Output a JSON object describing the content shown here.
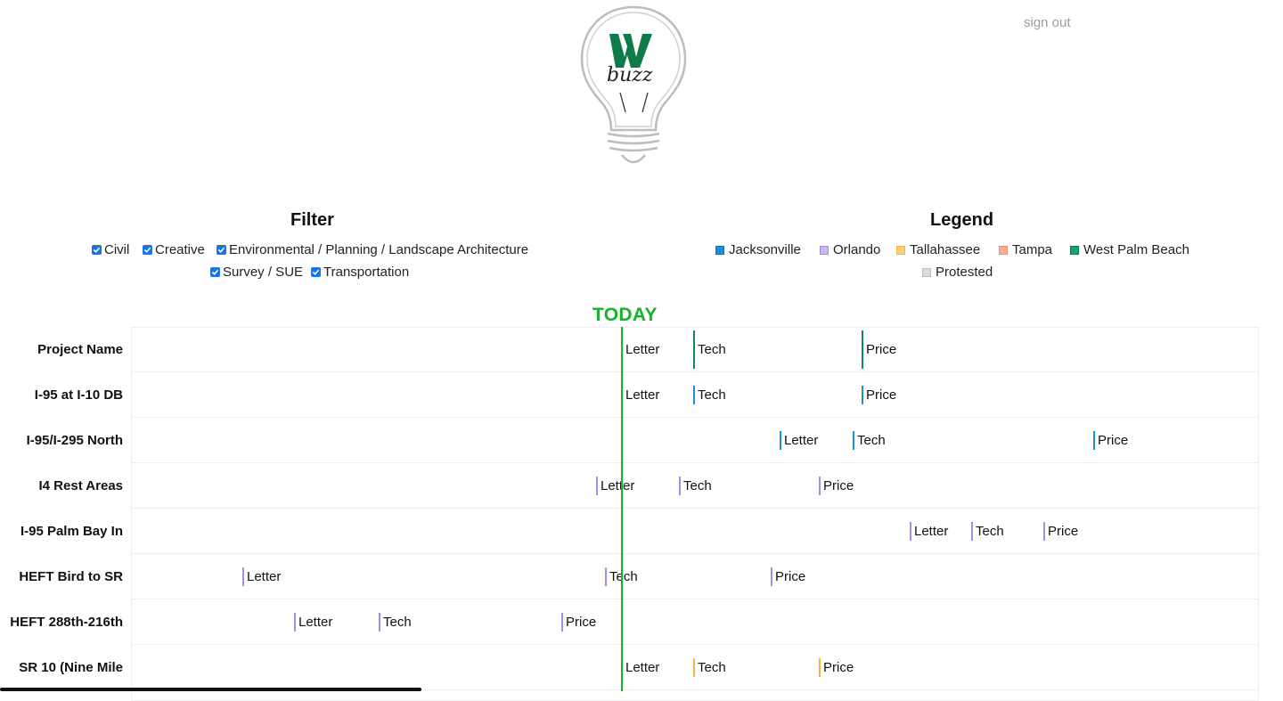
{
  "header": {
    "logo_icon": "lightbulb-wbuzz-logo",
    "logo_text": "buzz",
    "sign_out_label": "sign out"
  },
  "filter": {
    "title": "Filter",
    "options": [
      {
        "label": "Civil",
        "checked": true
      },
      {
        "label": "Creative",
        "checked": true
      },
      {
        "label": "Environmental / Planning / Landscape Architecture",
        "checked": true
      },
      {
        "label": "Survey / SUE",
        "checked": true
      },
      {
        "label": "Transportation",
        "checked": true
      }
    ]
  },
  "legend": {
    "title": "Legend",
    "items": [
      {
        "label": "Jacksonville",
        "color": "#1a8fd6"
      },
      {
        "label": "Orlando",
        "color": "#a98be6"
      },
      {
        "label": "Tallahassee",
        "color": "#f7b23e"
      },
      {
        "label": "Tampa",
        "color": "#f28b6e"
      },
      {
        "label": "West Palm Beach",
        "color": "#0f9d58"
      },
      {
        "label": "Protested",
        "color": "#d3d3d3"
      }
    ]
  },
  "timeline": {
    "today_label": "TODAY",
    "today_color": "#13b32a",
    "rows": [
      {
        "name": "Project Name",
        "color": "#0f8a5a",
        "markers": [
          {
            "label": "Letter"
          },
          {
            "label": "Tech"
          },
          {
            "label": "Price"
          }
        ]
      },
      {
        "name": "I-95 at I-10 DB",
        "color": "#1a8fd6",
        "markers": [
          {
            "label": "Letter"
          },
          {
            "label": "Tech"
          },
          {
            "label": "Price"
          }
        ]
      },
      {
        "name": "I-95/I-295 North",
        "color": "#1a8fd6",
        "markers": [
          {
            "label": "Letter"
          },
          {
            "label": "Tech"
          },
          {
            "label": "Price"
          }
        ]
      },
      {
        "name": "I4 Rest Areas",
        "color": "#a98be6",
        "markers": [
          {
            "label": "Letter"
          },
          {
            "label": "Tech"
          },
          {
            "label": "Price"
          }
        ]
      },
      {
        "name": "I-95 Palm Bay In",
        "color": "#a98be6",
        "markers": [
          {
            "label": "Letter"
          },
          {
            "label": "Tech"
          },
          {
            "label": "Price"
          }
        ]
      },
      {
        "name": "HEFT Bird to SR",
        "color": "#a98be6",
        "markers": [
          {
            "label": "Letter"
          },
          {
            "label": "Tech"
          },
          {
            "label": "Price"
          }
        ]
      },
      {
        "name": "HEFT 288th-216th",
        "color": "#a98be6",
        "markers": [
          {
            "label": "Letter"
          },
          {
            "label": "Tech"
          },
          {
            "label": "Price"
          }
        ]
      },
      {
        "name": "SR 10 (Nine Mile",
        "color": "#f7b23e",
        "markers": [
          {
            "label": "Letter"
          },
          {
            "label": "Tech"
          },
          {
            "label": "Price"
          }
        ]
      }
    ]
  }
}
